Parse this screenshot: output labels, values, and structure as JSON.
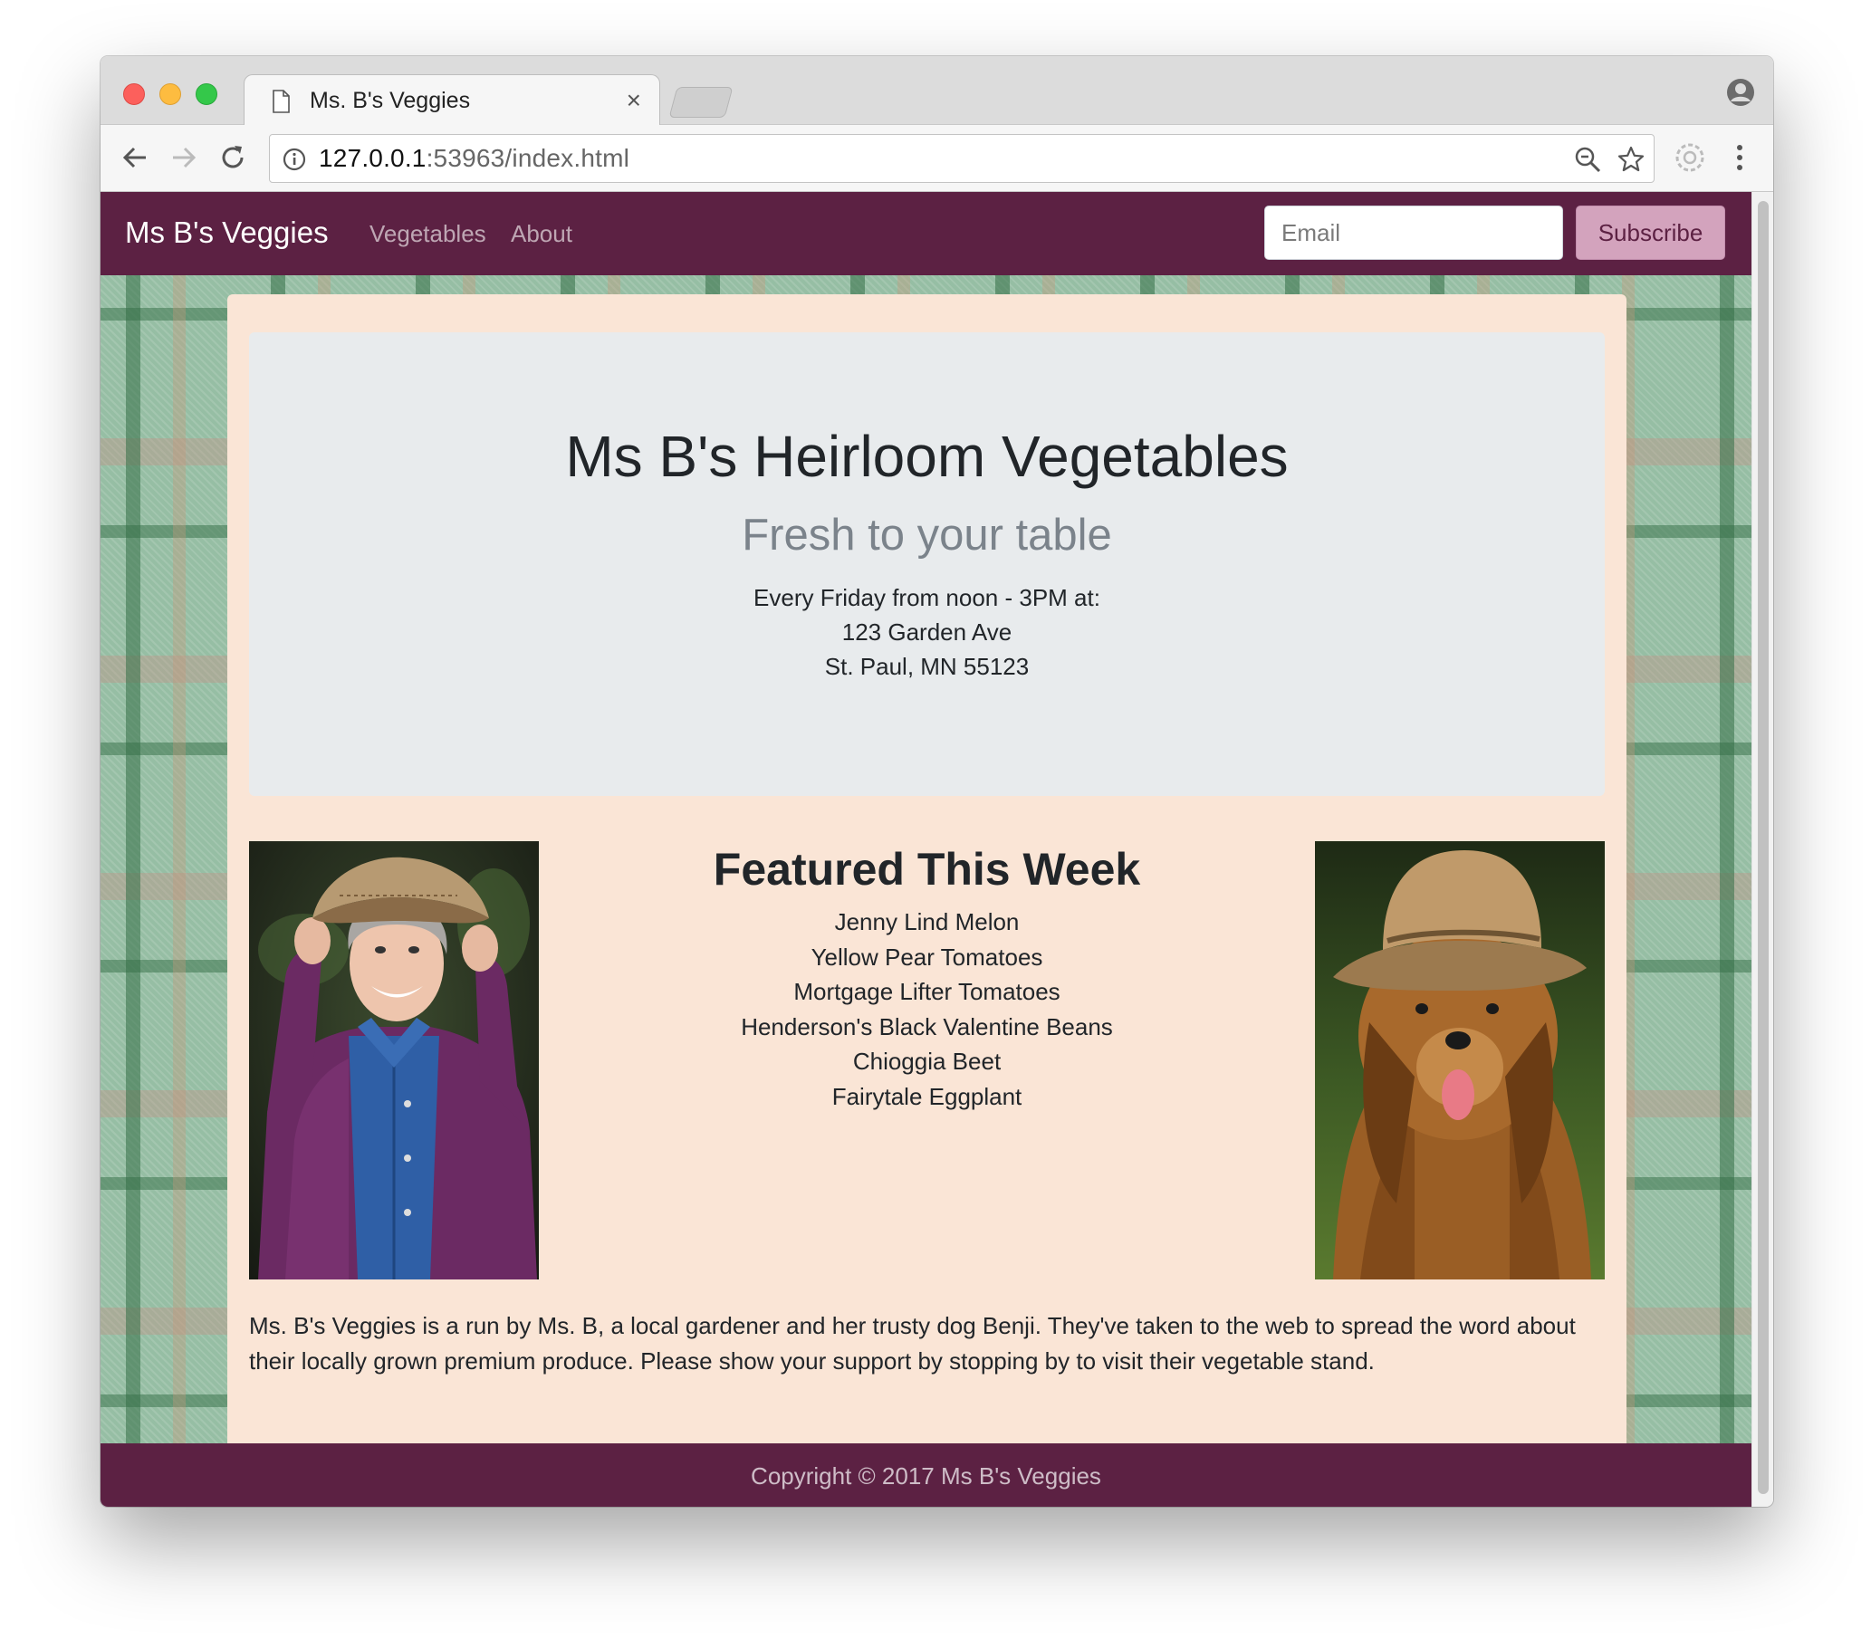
{
  "browser": {
    "tab_title": "Ms. B's Veggies",
    "tab_close": "×",
    "url_host": "127.0.0.1",
    "url_rest": ":53963/index.html"
  },
  "navbar": {
    "brand": "Ms B's Veggies",
    "links": [
      "Vegetables",
      "About"
    ],
    "email_placeholder": "Email",
    "subscribe_label": "Subscribe"
  },
  "jumbotron": {
    "title": "Ms B's Heirloom Vegetables",
    "subtitle": "Fresh to your table",
    "lines": [
      "Every Friday from noon - 3PM at:",
      "123 Garden Ave",
      "St. Paul, MN 55123"
    ]
  },
  "featured": {
    "title": "Featured This Week",
    "items": [
      "Jenny Lind Melon",
      "Yellow Pear Tomatoes",
      "Mortgage Lifter Tomatoes",
      "Henderson's Black Valentine Beans",
      "Chioggia Beet",
      "Fairytale Eggplant"
    ]
  },
  "about": {
    "text": "Ms. B's Veggies is a run by Ms. B, a local gardener and her trusty dog Benji. They've taken to the web to spread the word about their locally grown premium produce. Please show your support by stopping by to visit their vegetable stand."
  },
  "footer": {
    "copyright": "Copyright © 2017 Ms B's Veggies"
  },
  "colors": {
    "brand_plum": "#5c2143",
    "subscribe_pink": "#d3a3bd",
    "container_peach": "#fae5d6",
    "jumbotron_gray": "#e8ebed"
  },
  "icons": [
    "page-icon",
    "close-icon",
    "profile-icon",
    "back-icon",
    "forward-icon",
    "reload-icon",
    "info-icon",
    "zoom-icon",
    "star-icon",
    "extension-icon",
    "menu-icon"
  ]
}
